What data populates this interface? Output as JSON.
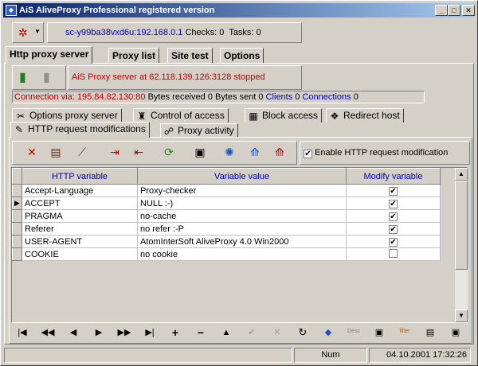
{
  "window": {
    "title": "AiS AliveProxy Professional registered version"
  },
  "title_buttons": {
    "minimize": "_",
    "maximize": "□",
    "close": "✕"
  },
  "connection": {
    "host": "sc-y99ba38vxd6u:192.168.0.1",
    "checks_label": "Checks:",
    "checks": "0",
    "tasks_label": "Tasks:",
    "tasks": "0"
  },
  "main_tabs": [
    "Http proxy server",
    "Proxy list",
    "Site test",
    "Options"
  ],
  "server": {
    "status": "AiS Proxy server at 62.118.139.126:3128 stopped"
  },
  "info": {
    "connection_via": "Connection via: 195.84.82.130:80",
    "bytes_received_label": "Bytes received",
    "bytes_received": "0",
    "bytes_sent_label": "Bytes sent",
    "bytes_sent": "0",
    "clients_label": "Clients",
    "clients": "0",
    "connections_label": "Connections",
    "connections": "0"
  },
  "panel_tabs_row1": [
    "Options proxy server",
    "Control of access",
    "Block access",
    "Redirect host"
  ],
  "panel_tabs_row2": [
    "HTTP request modifications",
    "Proxy activity"
  ],
  "enable_mod": {
    "label": "Enable HTTP request modification",
    "checked": true
  },
  "grid": {
    "columns": [
      "HTTP variable",
      "Variable value",
      "Modify variable"
    ],
    "rows": [
      {
        "var": "Accept-Language",
        "value": "Proxy-checker",
        "modify": true
      },
      {
        "var": "ACCEPT",
        "value": "NULL :-)",
        "modify": true,
        "current": true
      },
      {
        "var": "PRAGMA",
        "value": "no-cache",
        "modify": true
      },
      {
        "var": "Referer",
        "value": "no refer :-P",
        "modify": true
      },
      {
        "var": "USER-AGENT",
        "value": "AtomInterSoft AliveProxy 4.0 Win2000",
        "modify": true
      },
      {
        "var": "COOKIE",
        "value": "no cookie",
        "modify": false
      }
    ]
  },
  "nav_labels": {
    "desc": "Desc",
    "filter": "filter"
  },
  "statusbar": {
    "mode": "Num",
    "datetime": "04.10.2001 17:32:26"
  },
  "colors": {
    "accent_blue": "#0000c0",
    "status_red": "#c00000",
    "title_start": "#0a246a",
    "title_end": "#a6caf0"
  },
  "icons": {
    "toolbar": [
      "delete-icon",
      "clear-icon",
      "wand-icon",
      "export-icon",
      "import-icon",
      "refresh-icon",
      "save-icon",
      "network-icon",
      "chart-icon",
      "chart-red-icon"
    ],
    "navigator": [
      "first-icon",
      "prior-page-icon",
      "prior-icon",
      "next-icon",
      "next-page-icon",
      "last-icon",
      "insert-icon",
      "delete-icon",
      "edit-icon",
      "post-icon",
      "cancel-icon",
      "refresh-icon",
      "bookmark-icon",
      "desc-icon",
      "print-icon",
      "filter-icon",
      "report-icon",
      "save-icon"
    ]
  }
}
